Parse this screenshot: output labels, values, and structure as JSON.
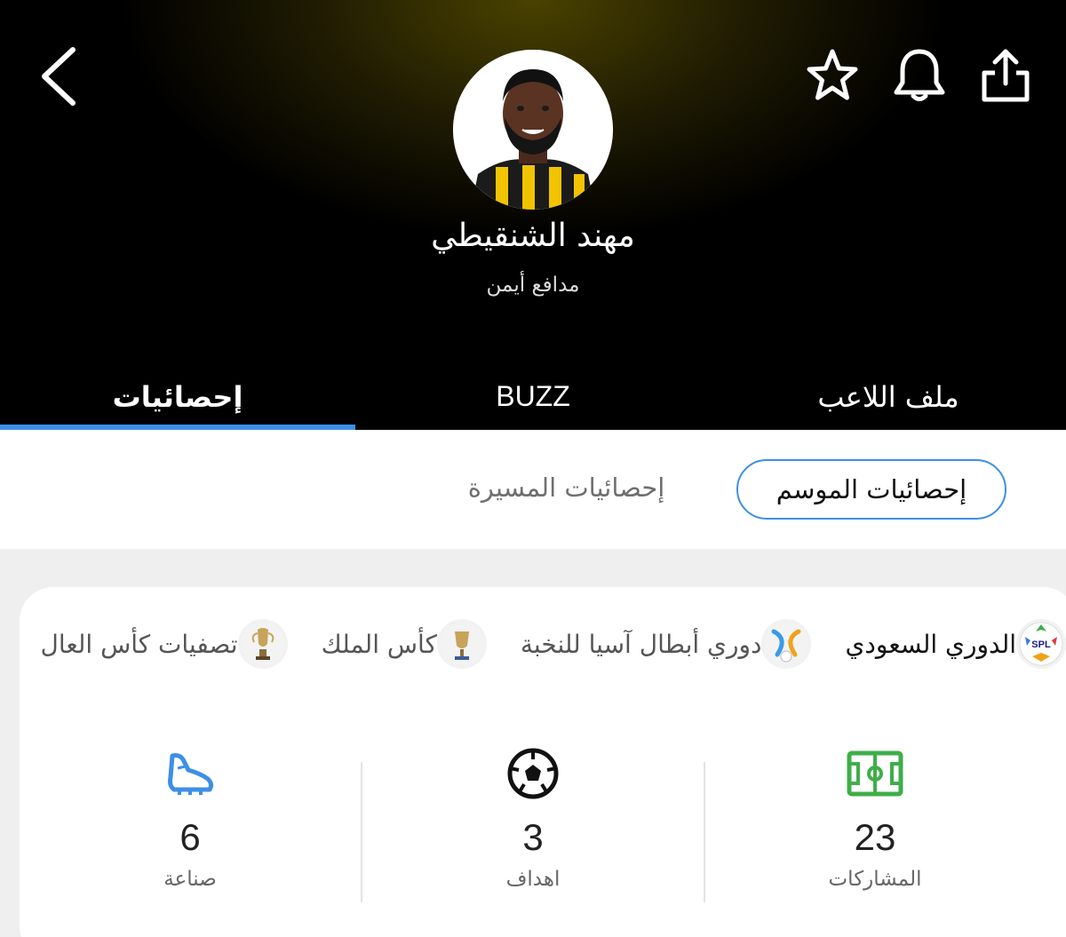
{
  "player": {
    "name": "مهند الشنقيطي",
    "position": "مدافع أيمن"
  },
  "tabs": [
    {
      "label": "إحصائيات",
      "active": true
    },
    {
      "label": "BUZZ",
      "active": false
    },
    {
      "label": "ملف اللاعب",
      "active": false
    }
  ],
  "stat_modes": {
    "season": "إحصائيات الموسم",
    "career": "إحصائيات المسيرة"
  },
  "competitions": [
    {
      "label": "الدوري السعودي",
      "icon": "spl-logo-icon",
      "active": true
    },
    {
      "label": "دوري أبطال آسيا للنخبة",
      "icon": "afc-logo-icon",
      "active": false
    },
    {
      "label": "كأس الملك",
      "icon": "kings-cup-icon",
      "active": false
    },
    {
      "label": "تصفيات كأس العال",
      "icon": "trophy-icon",
      "active": false
    }
  ],
  "stats": [
    {
      "value": "23",
      "label": "المشاركات",
      "icon": "pitch-icon",
      "color": "#3fae49"
    },
    {
      "value": "3",
      "label": "اهداف",
      "icon": "ball-icon",
      "color": "#111111"
    },
    {
      "value": "6",
      "label": "صناعة",
      "icon": "boot-icon",
      "color": "#3d8fe6"
    }
  ],
  "colors": {
    "accent": "#3d8fe6",
    "header_bg": "#000000",
    "header_glow": "#4a4200"
  }
}
